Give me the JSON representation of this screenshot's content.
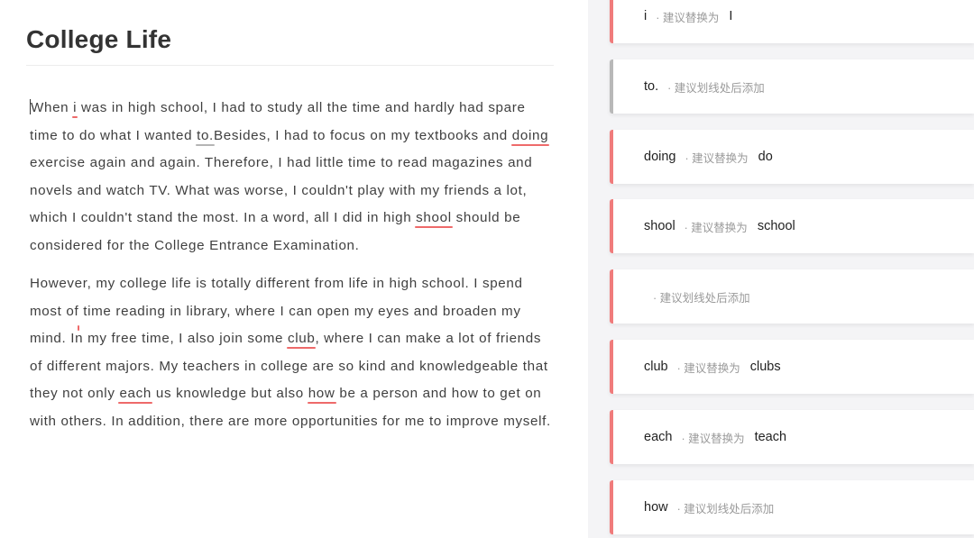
{
  "document": {
    "title": "College Life",
    "paragraph1": [
      {
        "t": "When "
      },
      {
        "t": "i",
        "err": "red"
      },
      {
        "t": " was in high school, I had to study all the time and hardly had spare time to do what I wanted "
      },
      {
        "t": "to.",
        "err": "grey"
      },
      {
        "t": "Besides, I had to focus on my textbooks and "
      },
      {
        "t": "doing",
        "err": "red"
      },
      {
        "t": " exercise again and again. Therefore, I had little time to read magazines and novels and watch TV. What was worse, I couldn't play with my friends a lot, which I couldn't stand the most. In a word, all I did in high "
      },
      {
        "t": "shool",
        "err": "red"
      },
      {
        "t": " should be considered for the College Entrance Examination."
      }
    ],
    "paragraph2": [
      {
        "t": "However, my college life is totally different from life in high school. I spend most of"
      },
      {
        "t": "",
        "insert": true
      },
      {
        "t": " time reading in library, where I can open my eyes and broaden my mind. In my free time, I also join some "
      },
      {
        "t": "club",
        "err": "red"
      },
      {
        "t": ", where I can make a lot of friends of different majors. My teachers in college are so kind and knowledgeable that they not only "
      },
      {
        "t": "each",
        "err": "red"
      },
      {
        "t": " us knowledge but also "
      },
      {
        "t": "how",
        "err": "red"
      },
      {
        "t": " be a person and how to get on with others. In addition, there are more opportunities for me to improve myself."
      }
    ]
  },
  "suggestions": [
    {
      "original": "i",
      "hint": "· 建议替换为",
      "replacement": "I",
      "color": "red"
    },
    {
      "original": "to.",
      "hint": "· 建议划线处后添加",
      "replacement": "",
      "color": "grey"
    },
    {
      "original": "doing",
      "hint": "· 建议替换为",
      "replacement": "do",
      "color": "red"
    },
    {
      "original": "shool",
      "hint": "· 建议替换为",
      "replacement": "school",
      "color": "red"
    },
    {
      "original": "",
      "hint": "· 建议划线处后添加",
      "replacement": "",
      "color": "red"
    },
    {
      "original": "club",
      "hint": "· 建议替换为",
      "replacement": "clubs",
      "color": "red"
    },
    {
      "original": "each",
      "hint": "· 建议替换为",
      "replacement": "teach",
      "color": "red"
    },
    {
      "original": "how",
      "hint": "· 建议划线处后添加",
      "replacement": "",
      "color": "red"
    }
  ],
  "colors": {
    "error": "#ee6a6a",
    "warning": "#b5b5b5",
    "panel_bg": "#f4f4f6"
  }
}
